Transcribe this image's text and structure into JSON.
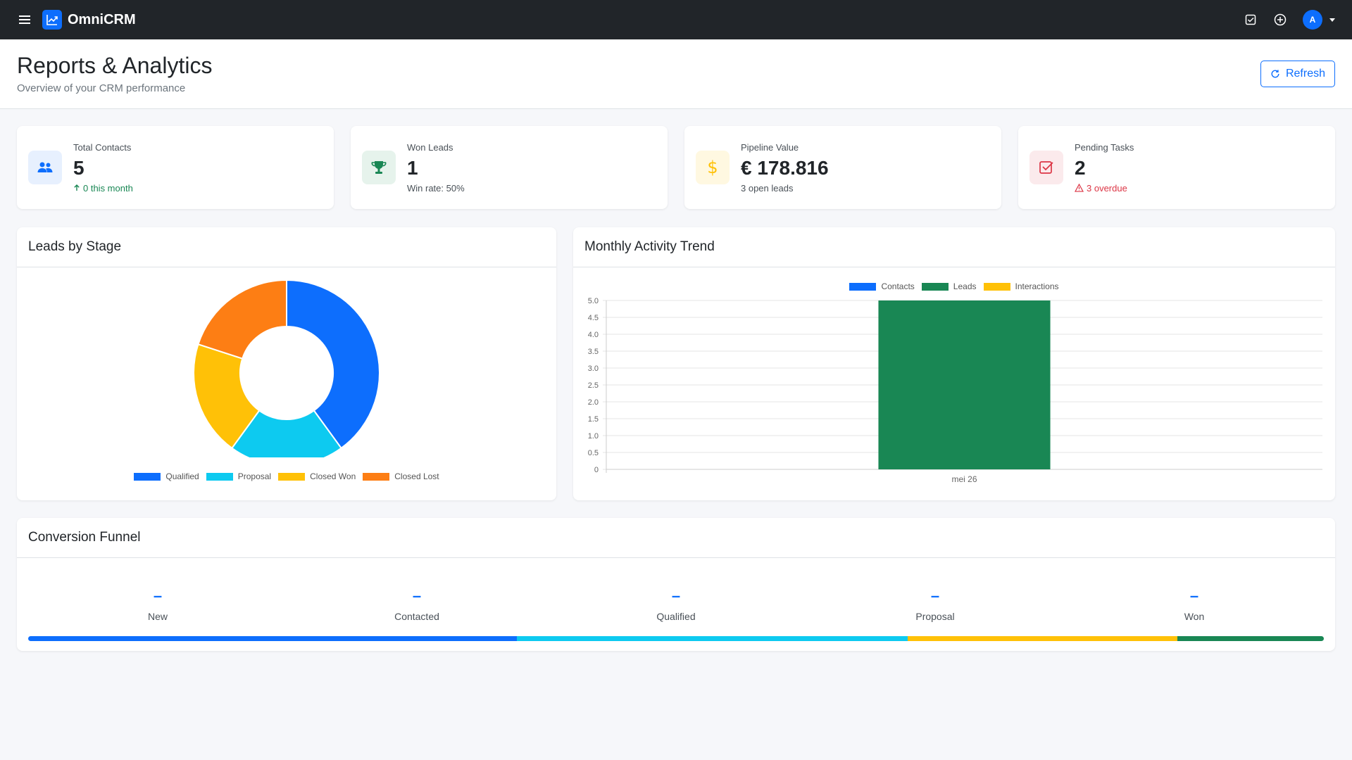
{
  "app": {
    "name": "OmniCRM"
  },
  "page": {
    "title": "Reports & Analytics",
    "subtitle": "Overview of your CRM performance",
    "refresh_label": "Refresh"
  },
  "user": {
    "initial": "A"
  },
  "stats": [
    {
      "label": "Total Contacts",
      "value": "5",
      "sub": "0 this month",
      "sub_color": "#198754",
      "icon": "people-icon",
      "icon_bg": "#e7f0fe",
      "icon_color": "#0d6efd"
    },
    {
      "label": "Won Leads",
      "value": "1",
      "sub": "Win rate: 50%",
      "sub_color": "#495057",
      "icon": "trophy-icon",
      "icon_bg": "#e6f3ec",
      "icon_color": "#198754"
    },
    {
      "label": "Pipeline Value",
      "value": "€ 178.816",
      "sub": "3 open leads",
      "sub_color": "#495057",
      "icon": "dollar-icon",
      "icon_bg": "#fff8e1",
      "icon_color": "#ffc107"
    },
    {
      "label": "Pending Tasks",
      "value": "2",
      "sub": "3 overdue",
      "sub_color": "#dc3545",
      "icon": "task-check-icon",
      "icon_bg": "#fbeaec",
      "icon_color": "#dc3545"
    }
  ],
  "leads_by_stage": {
    "title": "Leads by Stage",
    "chart_data": {
      "type": "pie",
      "categories": [
        "Qualified",
        "Proposal",
        "Closed Won",
        "Closed Lost"
      ],
      "values": [
        2,
        1,
        1,
        1
      ],
      "colors": [
        "#0d6efd",
        "#0dcaf0",
        "#ffc107",
        "#fd7e14"
      ],
      "donut": true,
      "legend": "bottom"
    }
  },
  "monthly_activity": {
    "title": "Monthly Activity Trend",
    "chart_data": {
      "type": "bar",
      "categories": [
        "mei 26"
      ],
      "series": [
        {
          "name": "Contacts",
          "values": [
            0
          ],
          "color": "#0d6efd"
        },
        {
          "name": "Leads",
          "values": [
            5
          ],
          "color": "#198754"
        },
        {
          "name": "Interactions",
          "values": [
            0
          ],
          "color": "#ffc107"
        }
      ],
      "ylim": [
        0,
        5
      ],
      "yticks": [
        "0",
        "0.5",
        "1.0",
        "1.5",
        "2.0",
        "2.5",
        "3.0",
        "3.5",
        "4.0",
        "4.5",
        "5.0"
      ],
      "grid": true,
      "legend": "top"
    }
  },
  "funnel": {
    "title": "Conversion Funnel",
    "stages": [
      {
        "label": "New",
        "count": "–"
      },
      {
        "label": "Contacted",
        "count": "–"
      },
      {
        "label": "Qualified",
        "count": "–"
      },
      {
        "label": "Proposal",
        "count": "–"
      },
      {
        "label": "Won",
        "count": "–"
      }
    ],
    "bar": [
      {
        "fraction": 0.377,
        "color": "#0d6efd"
      },
      {
        "fraction": 0.302,
        "color": "#0dcaf0"
      },
      {
        "fraction": 0.208,
        "color": "#ffc107"
      },
      {
        "fraction": 0.113,
        "color": "#198754"
      }
    ]
  }
}
